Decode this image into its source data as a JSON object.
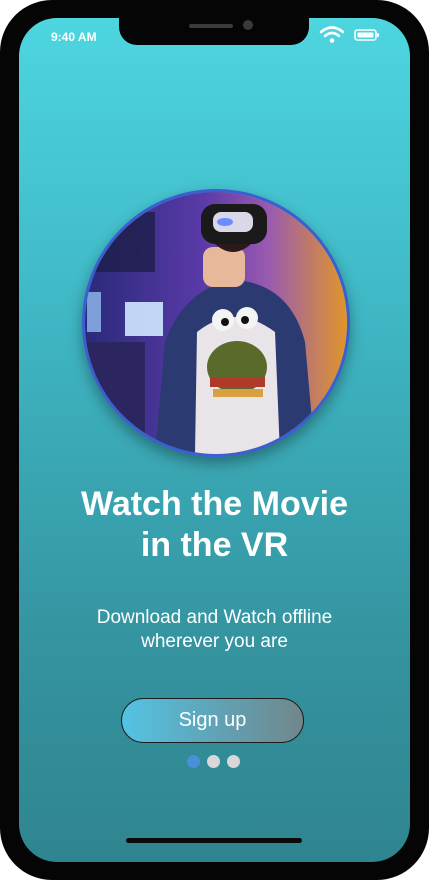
{
  "status_bar": {
    "time": "9:40 AM",
    "icons": [
      "wifi-icon",
      "battery-icon"
    ]
  },
  "hero": {
    "image": "person-wearing-vr-headset-photo"
  },
  "content": {
    "title_line1": "Watch the Movie",
    "title_line2": "in the VR",
    "subtitle_line1": "Download and Watch offline",
    "subtitle_line2": "wherever you are"
  },
  "actions": {
    "signup_label": "Sign up"
  },
  "pager": {
    "count": 3,
    "active_index": 0
  },
  "colors": {
    "background_top": "#4dd6e0",
    "background_bottom": "#2f858f",
    "avatar_border": "#3b5fd0",
    "dot_active": "#4a90d9",
    "dot_inactive": "#d8d8d8"
  }
}
